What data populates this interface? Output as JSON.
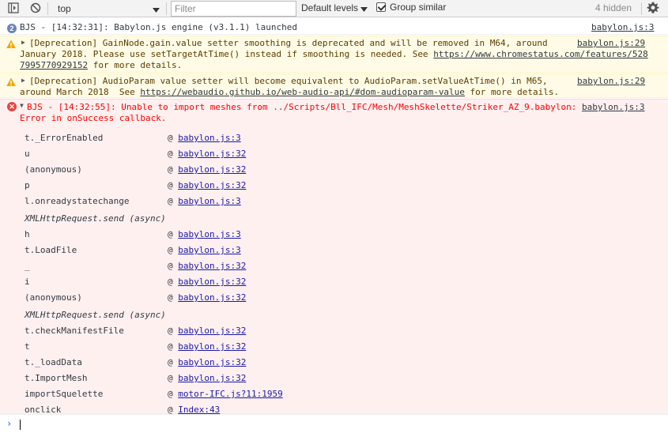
{
  "toolbar": {
    "context": "top",
    "filter_placeholder": "Filter",
    "levels_label": "Default levels",
    "group_similar_label": "Group similar",
    "hidden_count": "4 hidden"
  },
  "messages": {
    "info": {
      "count": "2",
      "text": "BJS - [14:32:31]: Babylon.js engine (v3.1.1) launched",
      "source": "babylon.js:3"
    },
    "warn1": {
      "line1_pre": "[Deprecation] GainNode.gain.value setter smoothing is deprecated and will be removed in M64, around",
      "line2_pre": "January 2018. Please use setTargetAtTime() instead if smoothing is needed. See ",
      "url": "https://www.chromestatus.com/features/528",
      "line3_url": "7995770929152",
      "line3_post": " for more details.",
      "source": "babylon.js:29"
    },
    "warn2": {
      "line1_pre": "[Deprecation] AudioParam value setter will become equivalent to AudioParam.setValueAtTime() in M65,",
      "line2_pre": "around March 2018  See ",
      "url": "https://webaudio.github.io/web-audio-api/#dom-audioparam-value",
      "line2_post": " for more details.",
      "source": "babylon.js:29"
    },
    "error": {
      "line1": "BJS - [14:32:55]: Unable to import meshes from ../Scripts/Bll_IFC/Mesh/MeshSkelette/Striker_AZ_9.babylon:",
      "line2": "Error in onSuccess callback.",
      "source": "babylon.js:3"
    }
  },
  "stack": [
    {
      "fn": "t._ErrorEnabled",
      "src": "babylon.js:3"
    },
    {
      "fn": "u",
      "src": "babylon.js:32"
    },
    {
      "fn": "(anonymous)",
      "src": "babylon.js:32"
    },
    {
      "fn": "p",
      "src": "babylon.js:32"
    },
    {
      "fn": "l.onreadystatechange",
      "src": "babylon.js:3"
    },
    {
      "async": "XMLHttpRequest.send (async)"
    },
    {
      "fn": "h",
      "src": "babylon.js:3"
    },
    {
      "fn": "t.LoadFile",
      "src": "babylon.js:3"
    },
    {
      "fn": "_",
      "src": "babylon.js:32"
    },
    {
      "fn": "i",
      "src": "babylon.js:32"
    },
    {
      "fn": "(anonymous)",
      "src": "babylon.js:32"
    },
    {
      "async": "XMLHttpRequest.send (async)"
    },
    {
      "fn": "t.checkManifestFile",
      "src": "babylon.js:32"
    },
    {
      "fn": "t",
      "src": "babylon.js:32"
    },
    {
      "fn": "t._loadData",
      "src": "babylon.js:32"
    },
    {
      "fn": "t.ImportMesh",
      "src": "babylon.js:32"
    },
    {
      "fn": "importSquelette",
      "src": "motor-IFC.js?11:1959"
    },
    {
      "fn": "onclick",
      "src": "Index:43"
    }
  ],
  "at_symbol": "@",
  "prompt_symbol": "›",
  "icons": {
    "sidebar": "sidebar-toggle-icon",
    "clear": "clear-console-icon",
    "dropdown": "chevron-down-icon",
    "settings": "gear-icon",
    "warning": "warning-icon",
    "error": "error-icon",
    "expand": "triangle-right-icon",
    "collapse": "triangle-down-icon"
  },
  "colors": {
    "warn_bg": "#fffbe6",
    "error_bg": "#fff0f0",
    "error_text": "#ff0000",
    "link_blue": "#1a1aa6"
  }
}
